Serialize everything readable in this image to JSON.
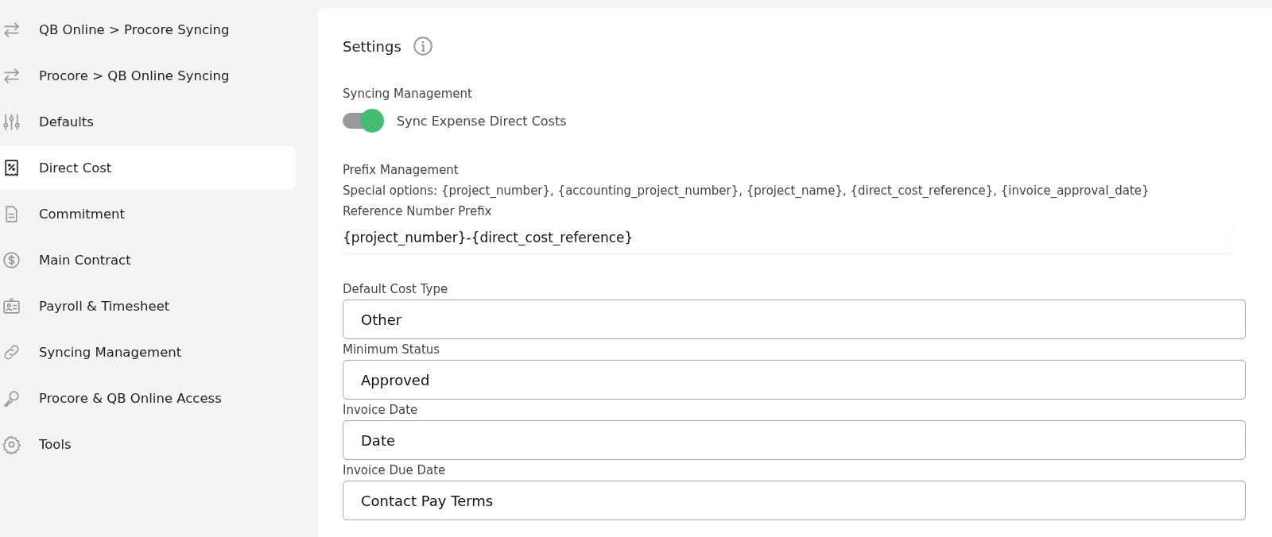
{
  "sidebar": {
    "items": [
      {
        "label": "QB Online > Procore Syncing",
        "selected": false
      },
      {
        "label": "Procore > QB Online Syncing",
        "selected": false
      },
      {
        "label": "Defaults",
        "selected": false
      },
      {
        "label": "Direct Cost",
        "selected": true
      },
      {
        "label": "Commitment",
        "selected": false
      },
      {
        "label": "Main Contract",
        "selected": false
      },
      {
        "label": "Payroll & Timesheet",
        "selected": false
      },
      {
        "label": "Syncing Management",
        "selected": false
      },
      {
        "label": "Procore & QB Online Access",
        "selected": false
      },
      {
        "label": "Tools",
        "selected": false
      }
    ]
  },
  "settings": {
    "title": "Settings",
    "syncing_management": {
      "heading": "Syncing Management",
      "toggle": {
        "label": "Sync Expense Direct Costs",
        "on": true
      }
    },
    "prefix_management": {
      "heading": "Prefix Management",
      "special_options": "Special options: {project_number}, {accounting_project_number}, {project_name}, {direct_cost_reference}, {invoice_approval_date}",
      "field_label": "Reference Number Prefix",
      "value": "{project_number}-{direct_cost_reference}"
    },
    "fields": [
      {
        "label": "Default Cost Type",
        "value": "Other"
      },
      {
        "label": "Minimum Status",
        "value": "Approved"
      },
      {
        "label": "Invoice Date",
        "value": "Date"
      },
      {
        "label": "Invoice Due Date",
        "value": "Contact Pay Terms"
      }
    ]
  }
}
